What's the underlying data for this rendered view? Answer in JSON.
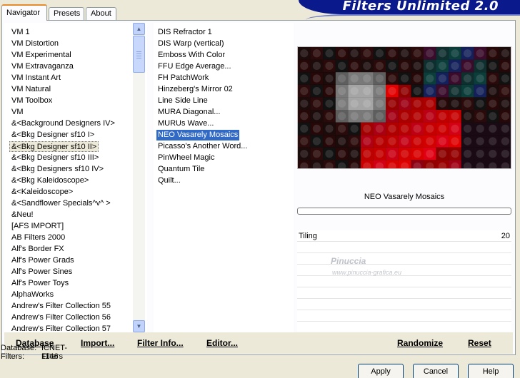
{
  "tabs": [
    "Navigator",
    "Presets",
    "About"
  ],
  "banner": "Filters Unlimited 2.0",
  "categories": [
    "VM 1",
    "VM Distortion",
    "VM Experimental",
    "VM Extravaganza",
    "VM Instant Art",
    "VM Natural",
    "VM Toolbox",
    "VM",
    "&<Background Designers IV>",
    "&<Bkg Designer sf10 I>",
    "&<Bkg Designer sf10 II>",
    "&<Bkg Designer sf10 III>",
    "&<Bkg Designers sf10 IV>",
    "&<Bkg Kaleidoscope>",
    "&<Kaleidoscope>",
    "&<Sandflower Specials^v^ >",
    "&Neu!",
    "[AFS IMPORT]",
    "AB Filters 2000",
    "Alf's Border FX",
    "Alf's Power Grads",
    "Alf's Power Sines",
    "Alf's Power Toys",
    "AlphaWorks",
    "Andrew's Filter Collection 55",
    "Andrew's Filter Collection 56",
    "Andrew's Filter Collection 57"
  ],
  "selected_category": "&<Bkg Designer sf10 II>",
  "filters": [
    "DIS Refractor 1",
    "DIS Warp (vertical)",
    "Emboss With Color",
    "FFU Edge Average...",
    "FH PatchWork",
    "Hinzeberg's Mirror 02",
    "Line Side Line",
    "MURA Diagonal...",
    "MURUs Wave...",
    "NEO Vasarely Mosaics",
    "Picasso's Another Word...",
    "PinWheel Magic",
    "Quantum Tile",
    "Quilt..."
  ],
  "selected_filter": "NEO Vasarely Mosaics",
  "filter_title": "NEO Vasarely Mosaics",
  "param": {
    "label": "Tiling",
    "value": "20"
  },
  "watermark": {
    "name": "Pinuccia",
    "url": "www.pinuccia-grafica.eu"
  },
  "toolbar": {
    "database": "Database",
    "import": "Import...",
    "filter_info": "Filter Info...",
    "editor": "Editor...",
    "randomize": "Randomize",
    "reset": "Reset"
  },
  "status": {
    "database_label": "Database:",
    "database_value": "ICNET-Filters",
    "filters_label": "Filters:",
    "filters_value": "1146"
  },
  "buttons": {
    "apply": "Apply",
    "cancel": "Cancel",
    "help": "Help"
  },
  "colors": {
    "selection": "#316ac5",
    "banner": "#0a1a8c",
    "tab_accent": "#e68b2c"
  },
  "icons": {
    "scroll_up": "chevron-up-icon",
    "scroll_down": "chevron-down-icon"
  }
}
